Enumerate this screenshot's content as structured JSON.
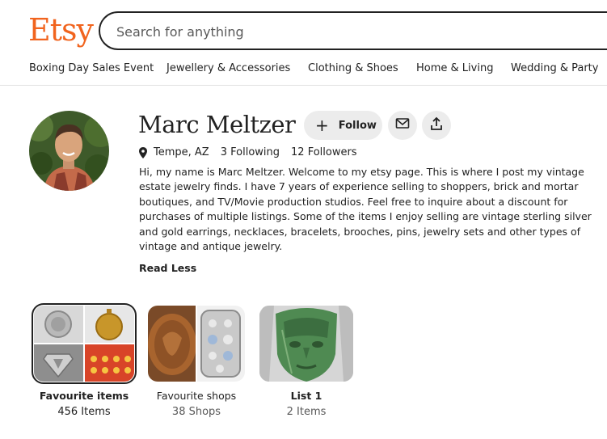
{
  "header": {
    "logo": "Etsy",
    "search_placeholder": "Search for anything"
  },
  "nav": {
    "items": [
      "Boxing Day Sales Event",
      "Jewellery & Accessories",
      "Clothing & Shoes",
      "Home & Living",
      "Wedding & Party"
    ]
  },
  "profile": {
    "name": "Marc Meltzer",
    "follow_label": "Follow",
    "location": "Tempe, AZ",
    "following": "3 Following",
    "followers": "12 Followers",
    "bio": "Hi, my name is Marc Meltzer. Welcome to my etsy page. This is where I post my vintage estate jewelry finds. I have 7 years of experience selling to shoppers, brick and mortar boutiques, and TV/Movie production studios. Feel free to inquire about a discount for purchases of multiple listings. Some of the items I enjoy selling are vintage sterling silver and gold earrings, necklaces, bracelets, brooches, pins, jewelry sets and other types of vintage and antique jewelry.",
    "read_less": "Read Less"
  },
  "collections": [
    {
      "title": "Favourite items",
      "count": "456 Items"
    },
    {
      "title": "Favourite shops",
      "count": "38 Shops"
    },
    {
      "title": "List 1",
      "count": "2 Items"
    }
  ],
  "icons": {
    "follow": "plus-icon",
    "message": "envelope-icon",
    "share": "share-icon",
    "location": "map-pin-icon"
  },
  "colors": {
    "brand": "#f1641e",
    "button_bg": "#ececec",
    "text": "#222222",
    "muted": "#595959"
  }
}
